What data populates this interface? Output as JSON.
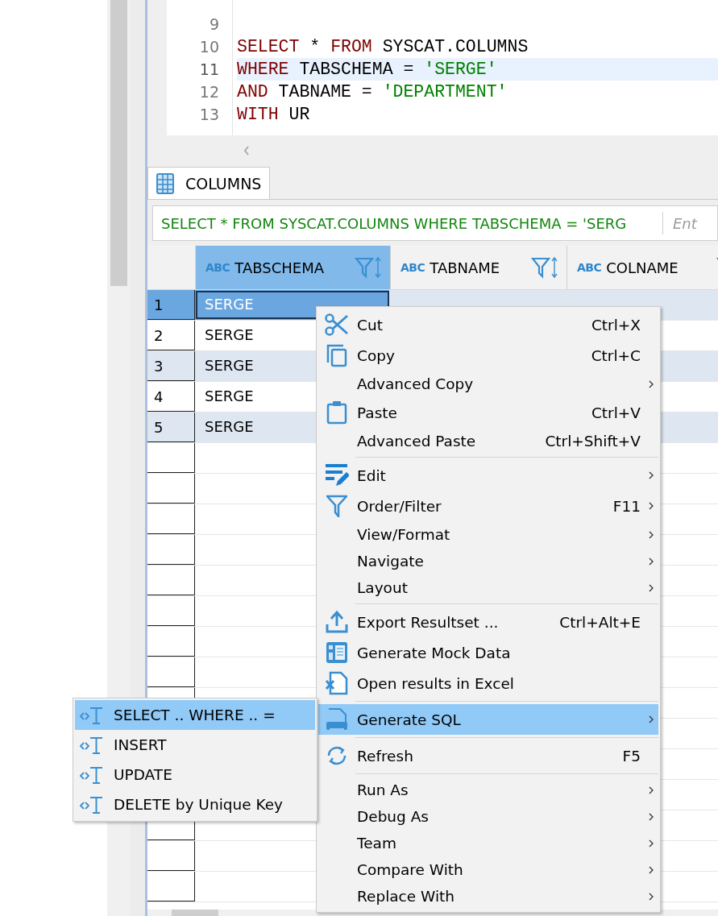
{
  "editor": {
    "lines": [
      {
        "number": "9",
        "current": false
      },
      {
        "number": "10",
        "current": false,
        "tokens": [
          {
            "kind": "keyword",
            "text": "SELECT"
          },
          {
            "kind": "plain",
            "text": " * "
          },
          {
            "kind": "keyword",
            "text": "FROM"
          },
          {
            "kind": "plain",
            "text": " SYSCAT.COLUMNS"
          }
        ]
      },
      {
        "number": "11",
        "current": true,
        "tokens": [
          {
            "kind": "keyword",
            "text": "WHERE"
          },
          {
            "kind": "plain",
            "text": " TABSCHEMA = "
          },
          {
            "kind": "string",
            "text": "'SERGE'"
          }
        ]
      },
      {
        "number": "12",
        "current": false,
        "tokens": [
          {
            "kind": "keyword",
            "text": "AND"
          },
          {
            "kind": "plain",
            "text": " TABNAME = "
          },
          {
            "kind": "string",
            "text": "'DEPARTMENT'"
          }
        ]
      },
      {
        "number": "13",
        "current": false,
        "tokens": [
          {
            "kind": "keyword",
            "text": "WITH"
          },
          {
            "kind": "plain",
            "text": " UR"
          }
        ]
      }
    ]
  },
  "results_tab": {
    "label": "COLUMNS",
    "selected": true
  },
  "filter_bar": {
    "query": "SELECT * FROM SYSCAT.COLUMNS WHERE TABSCHEMA = 'SERG",
    "placeholder": "Ent"
  },
  "grid": {
    "columns": [
      {
        "type_badge": "ABC",
        "name": "TABSCHEMA",
        "selected": true
      },
      {
        "type_badge": "ABC",
        "name": "TABNAME",
        "selected": false
      },
      {
        "type_badge": "ABC",
        "name": "COLNAME",
        "selected": false
      }
    ],
    "rows": [
      {
        "number": "1",
        "selected": true,
        "cells": [
          "SERGE"
        ]
      },
      {
        "number": "2",
        "selected": false,
        "cells": [
          "SERGE"
        ]
      },
      {
        "number": "3",
        "selected": false,
        "cells": [
          "SERGE"
        ]
      },
      {
        "number": "4",
        "selected": false,
        "cells": [
          "SERGE"
        ]
      },
      {
        "number": "5",
        "selected": false,
        "cells": [
          "SERGE"
        ]
      }
    ]
  },
  "context_menu": {
    "items": [
      {
        "kind": "item",
        "label": "Cut",
        "shortcut": "Ctrl+X",
        "submenu": false,
        "selected": false
      },
      {
        "kind": "item",
        "label": "Copy",
        "shortcut": "Ctrl+C",
        "submenu": false,
        "selected": false
      },
      {
        "kind": "item",
        "label": "Advanced Copy",
        "submenu": true,
        "selected": false
      },
      {
        "kind": "item",
        "label": "Paste",
        "shortcut": "Ctrl+V",
        "submenu": false,
        "selected": false
      },
      {
        "kind": "item",
        "label": "Advanced Paste",
        "shortcut": "Ctrl+Shift+V",
        "submenu": false,
        "selected": false
      },
      {
        "kind": "separator"
      },
      {
        "kind": "item",
        "label": "Edit",
        "submenu": true,
        "selected": false
      },
      {
        "kind": "item",
        "label": "Order/Filter",
        "shortcut": "F11",
        "submenu": true,
        "selected": false
      },
      {
        "kind": "item",
        "label": "View/Format",
        "submenu": true,
        "selected": false
      },
      {
        "kind": "item",
        "label": "Navigate",
        "submenu": true,
        "selected": false
      },
      {
        "kind": "item",
        "label": "Layout",
        "submenu": true,
        "selected": false
      },
      {
        "kind": "separator"
      },
      {
        "kind": "item",
        "label": "Export Resultset ...",
        "shortcut": "Ctrl+Alt+E",
        "submenu": false,
        "selected": false
      },
      {
        "kind": "item",
        "label": "Generate Mock Data",
        "submenu": false,
        "selected": false
      },
      {
        "kind": "item",
        "label": "Open results in Excel",
        "submenu": false,
        "selected": false
      },
      {
        "kind": "separator"
      },
      {
        "kind": "item",
        "label": "Generate SQL",
        "submenu": true,
        "selected": true
      },
      {
        "kind": "separator"
      },
      {
        "kind": "item",
        "label": "Refresh",
        "shortcut": "F5",
        "submenu": false,
        "selected": false
      },
      {
        "kind": "separator"
      },
      {
        "kind": "item",
        "label": "Run As",
        "submenu": true,
        "selected": false
      },
      {
        "kind": "item",
        "label": "Debug As",
        "submenu": true,
        "selected": false
      },
      {
        "kind": "item",
        "label": "Team",
        "submenu": true,
        "selected": false
      },
      {
        "kind": "item",
        "label": "Compare With",
        "submenu": true,
        "selected": false
      },
      {
        "kind": "item",
        "label": "Replace With",
        "submenu": true,
        "selected": false
      }
    ]
  },
  "submenu": {
    "items": [
      {
        "label": "SELECT .. WHERE .. =",
        "selected": true
      },
      {
        "label": "INSERT",
        "selected": false
      },
      {
        "label": "UPDATE",
        "selected": false
      },
      {
        "label": "DELETE by Unique Key",
        "selected": false
      }
    ]
  }
}
